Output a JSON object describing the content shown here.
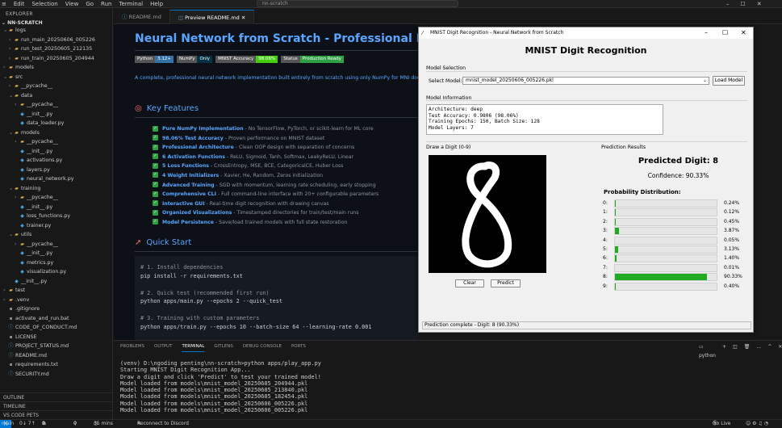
{
  "menu": [
    "Edit",
    "Selection",
    "View",
    "Go",
    "Run",
    "Terminal",
    "Help"
  ],
  "search_text": "nn-scratch",
  "explorer": {
    "title": "EXPLORER",
    "root": "NN-SCRATCH",
    "items": [
      {
        "label": "logs",
        "kind": "fold",
        "indent": 1,
        "arrow": "v"
      },
      {
        "label": "run_main_20250606_005226",
        "kind": "fold",
        "indent": 2,
        "arrow": ">"
      },
      {
        "label": "run_test_20250605_212135",
        "kind": "fold",
        "indent": 2,
        "arrow": ">"
      },
      {
        "label": "run_train_20250605_204944",
        "kind": "fold",
        "indent": 2,
        "arrow": ">"
      },
      {
        "label": "models",
        "kind": "fold",
        "indent": 1,
        "arrow": ">"
      },
      {
        "label": "src",
        "kind": "fold",
        "indent": 1,
        "arrow": "v"
      },
      {
        "label": "__pycache__",
        "kind": "fold",
        "indent": 2,
        "arrow": ">"
      },
      {
        "label": "data",
        "kind": "fold",
        "indent": 2,
        "arrow": "v"
      },
      {
        "label": "__pycache__",
        "kind": "fold",
        "indent": 3,
        "arrow": ">"
      },
      {
        "label": "__init__.py",
        "kind": "py",
        "indent": 3,
        "arrow": ""
      },
      {
        "label": "data_loader.py",
        "kind": "py",
        "indent": 3,
        "arrow": ""
      },
      {
        "label": "models",
        "kind": "fold",
        "indent": 2,
        "arrow": "v"
      },
      {
        "label": "__pycache__",
        "kind": "fold",
        "indent": 3,
        "arrow": ">"
      },
      {
        "label": "__init__.py",
        "kind": "py",
        "indent": 3,
        "arrow": ""
      },
      {
        "label": "activations.py",
        "kind": "py",
        "indent": 3,
        "arrow": ""
      },
      {
        "label": "layers.py",
        "kind": "py",
        "indent": 3,
        "arrow": ""
      },
      {
        "label": "neural_network.py",
        "kind": "py",
        "indent": 3,
        "arrow": ""
      },
      {
        "label": "training",
        "kind": "fold",
        "indent": 2,
        "arrow": "v"
      },
      {
        "label": "__pycache__",
        "kind": "fold",
        "indent": 3,
        "arrow": ">"
      },
      {
        "label": "__init__.py",
        "kind": "py",
        "indent": 3,
        "arrow": ""
      },
      {
        "label": "loss_functions.py",
        "kind": "py",
        "indent": 3,
        "arrow": ""
      },
      {
        "label": "trainer.py",
        "kind": "py",
        "indent": 3,
        "arrow": ""
      },
      {
        "label": "utils",
        "kind": "fold",
        "indent": 2,
        "arrow": "v"
      },
      {
        "label": "__pycache__",
        "kind": "fold",
        "indent": 3,
        "arrow": ">"
      },
      {
        "label": "__init__.py",
        "kind": "py",
        "indent": 3,
        "arrow": ""
      },
      {
        "label": "metrics.py",
        "kind": "py",
        "indent": 3,
        "arrow": ""
      },
      {
        "label": "visualization.py",
        "kind": "py",
        "indent": 3,
        "arrow": ""
      },
      {
        "label": "__init__.py",
        "kind": "py",
        "indent": 2,
        "arrow": ""
      },
      {
        "label": "test",
        "kind": "fold",
        "indent": 1,
        "arrow": ">"
      },
      {
        "label": ".venv",
        "kind": "fold",
        "indent": 1,
        "arrow": ">"
      },
      {
        "label": ".gitignore",
        "kind": "grey",
        "indent": 1,
        "arrow": ""
      },
      {
        "label": "activate_and_run.bat",
        "kind": "grey",
        "indent": 1,
        "arrow": ""
      },
      {
        "label": "CODE_OF_CONDUCT.md",
        "kind": "md",
        "indent": 1,
        "arrow": ""
      },
      {
        "label": "LICENSE",
        "kind": "grey",
        "indent": 1,
        "arrow": ""
      },
      {
        "label": "PROJECT_STATUS.md",
        "kind": "md",
        "indent": 1,
        "arrow": ""
      },
      {
        "label": "README.md",
        "kind": "md",
        "indent": 1,
        "arrow": ""
      },
      {
        "label": "requirements.txt",
        "kind": "grey",
        "indent": 1,
        "arrow": ""
      },
      {
        "label": "SECURITY.md",
        "kind": "md",
        "indent": 1,
        "arrow": ""
      }
    ],
    "outline": [
      "OUTLINE",
      "TIMELINE",
      "VS CODE PETS"
    ]
  },
  "tabs": [
    "README.md",
    "Preview README.md"
  ],
  "readme": {
    "title": "Neural Network from Scratch - Professional Implemen",
    "badges": [
      {
        "k": "Python",
        "v": "3.12+",
        "color": "#3572a5"
      },
      {
        "k": "NumPy",
        "v": "Only",
        "color": "#013243"
      },
      {
        "k": "MNIST Accuracy",
        "v": "98.06%",
        "color": "#4c1"
      },
      {
        "k": "Status",
        "v": "Production Ready",
        "color": "#2ea043"
      }
    ],
    "description": "A complete, professional neural network implementation built entirely from scratch using only NumPy for MNI documentation.",
    "features_heading": "Key Features",
    "features": [
      {
        "b": "Pure NumPy Implementation",
        "t": " - No TensorFlow, PyTorch, or scikit-learn for ML core"
      },
      {
        "b": "98.06% Test Accuracy",
        "t": " - Proven performance on MNIST dataset"
      },
      {
        "b": "Professional Architecture",
        "t": " - Clean OOP design with separation of concerns"
      },
      {
        "b": "6 Activation Functions",
        "t": " - ReLU, Sigmoid, Tanh, Softmax, LeakyReLU, Linear"
      },
      {
        "b": "5 Loss Functions",
        "t": " - CrossEntropy, MSE, BCE, CategoricalCE, Huber Loss"
      },
      {
        "b": "4 Weight Initializers",
        "t": " - Xavier, He, Random, Zeros initialization"
      },
      {
        "b": "Advanced Training",
        "t": " - SGD with momentum, learning rate scheduling, early stopping"
      },
      {
        "b": "Comprehensive CLI",
        "t": " - Full command-line interface with 20+ configurable parameters"
      },
      {
        "b": "Interactive GUI",
        "t": " - Real-time digit recognition with drawing canvas"
      },
      {
        "b": "Organized Visualizations",
        "t": " - Timestamped directories for train/test/main runs"
      },
      {
        "b": "Model Persistence",
        "t": " - Save/load trained models with full state restoration"
      }
    ],
    "quick_heading": "Quick Start",
    "code": [
      {
        "c": "cm",
        "t": "# 1. Install dependencies"
      },
      {
        "c": "cd",
        "t": "pip install -r requirements.txt"
      },
      {
        "c": "cd",
        "t": " "
      },
      {
        "c": "cm",
        "t": "# 2. Quick test (recommended first run)"
      },
      {
        "c": "cd",
        "t": "python apps/main.py --epochs 2 --quick_test"
      },
      {
        "c": "cd",
        "t": " "
      },
      {
        "c": "cm",
        "t": "# 3. Training with custom parameters"
      },
      {
        "c": "cd",
        "t": "python apps/train.py --epochs 10 --batch-size 64 --learning-rate 0.001"
      }
    ]
  },
  "panel": {
    "tabs": [
      "PROBLEMS",
      "OUTPUT",
      "TERMINAL",
      "GITLENS",
      "DEBUG CONSOLE",
      "PORTS"
    ],
    "active": "TERMINAL",
    "shell": "python",
    "terminal": [
      "(venv) D:\\ngoding penting\\nn-scratch>python apps/play_app.py",
      "Starting MNIST Digit Recognition App...",
      "Draw a digit and click 'Predict' to test your trained model!",
      "Model loaded from models\\mnist_model_20250605_204944.pkl",
      "Model loaded from models\\mnist_model_20250605_213840.pkl",
      "Model loaded from models\\mnist_model_20250605_182454.pkl",
      "Model loaded from models\\mnist_model_20250606_005226.pkl",
      "Model loaded from models\\mnist_model_20250606_005226.pkl"
    ]
  },
  "status": {
    "branch": "main",
    "sync": "0↓ 7↑",
    "errors": "0",
    "warnings": "0",
    "ports": "0",
    "time": "35 mins",
    "discord": "Reconnect to Discord",
    "golive": "Go Live"
  },
  "dialog": {
    "window_title": "MNIST Digit Recognition - Neural Network from Scratch",
    "heading": "MNIST Digit Recognition",
    "model_selection": "Model Selection",
    "select_label": "Select Model:",
    "selected_model": "mnist_model_20250606_005226.pkl",
    "load_button": "Load Model",
    "model_info_label": "Model Information",
    "model_info": [
      "Architecture: deep",
      "Test Accuracy: 0.9806 (98.06%)",
      "Training Epochs: 150, Batch Size: 128",
      "Model Layers: 7"
    ],
    "draw_label": "Draw a Digit (0-9)",
    "clear_button": "Clear",
    "predict_button": "Predict",
    "results_label": "Prediction Results",
    "predicted": "Predicted Digit: 8",
    "confidence": "Confidence: 90.33%",
    "dist_label": "Probability Distribution:",
    "probabilities": [
      {
        "digit": "0:",
        "value": 0.24,
        "label": "0.24%"
      },
      {
        "digit": "1:",
        "value": 0.12,
        "label": "0.12%"
      },
      {
        "digit": "2:",
        "value": 0.45,
        "label": "0.45%"
      },
      {
        "digit": "3:",
        "value": 3.87,
        "label": "3.87%"
      },
      {
        "digit": "4:",
        "value": 0.05,
        "label": "0.05%"
      },
      {
        "digit": "5:",
        "value": 3.13,
        "label": "3.13%"
      },
      {
        "digit": "6:",
        "value": 1.4,
        "label": "1.40%"
      },
      {
        "digit": "7:",
        "value": 0.01,
        "label": "0.01%"
      },
      {
        "digit": "8:",
        "value": 90.33,
        "label": "90.33%"
      },
      {
        "digit": "9:",
        "value": 0.4,
        "label": "0.40%"
      }
    ],
    "bar_color": "#22aa22",
    "status": "Prediction complete - Digit: 8 (90.33%)"
  }
}
